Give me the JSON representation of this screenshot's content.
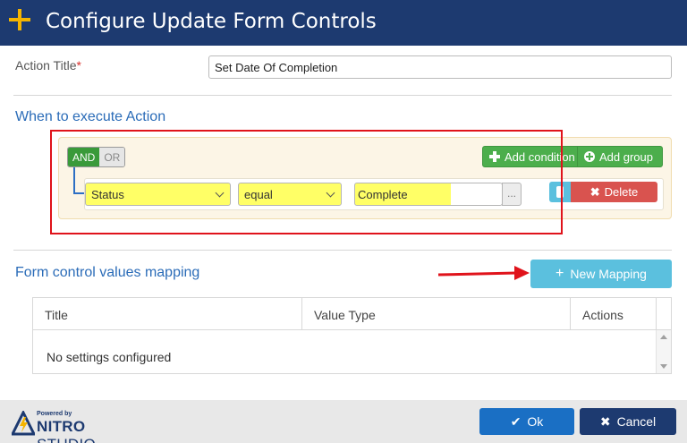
{
  "dialog": {
    "title": "Configure Update Form Controls",
    "header_bg": "#1d3a70",
    "icon": "plus-icon"
  },
  "action_title": {
    "label": "Action Title",
    "required_marker": "*",
    "value": "Set Date Of Completion"
  },
  "execute_section": {
    "title": "When to execute Action",
    "logic": {
      "and_label": "AND",
      "or_label": "OR",
      "selected": "AND"
    },
    "add_condition_label": "Add condition",
    "add_group_label": "Add group",
    "rule": {
      "field": "Status",
      "operator": "equal",
      "value": "Complete",
      "more_label": "...",
      "delete_label": "Delete"
    },
    "highlight_color": "#ffff66",
    "annotation_color": "#e0131b"
  },
  "mapping_section": {
    "title": "Form control values mapping",
    "new_mapping_label": "New Mapping",
    "columns": [
      "Title",
      "Value Type",
      "Actions"
    ],
    "empty_text": "No settings configured"
  },
  "footer": {
    "logo_powered": "Powered by",
    "logo_brand_bold": "NITRO",
    "logo_brand_light": "STUDIO",
    "ok_label": "Ok",
    "cancel_label": "Cancel"
  }
}
